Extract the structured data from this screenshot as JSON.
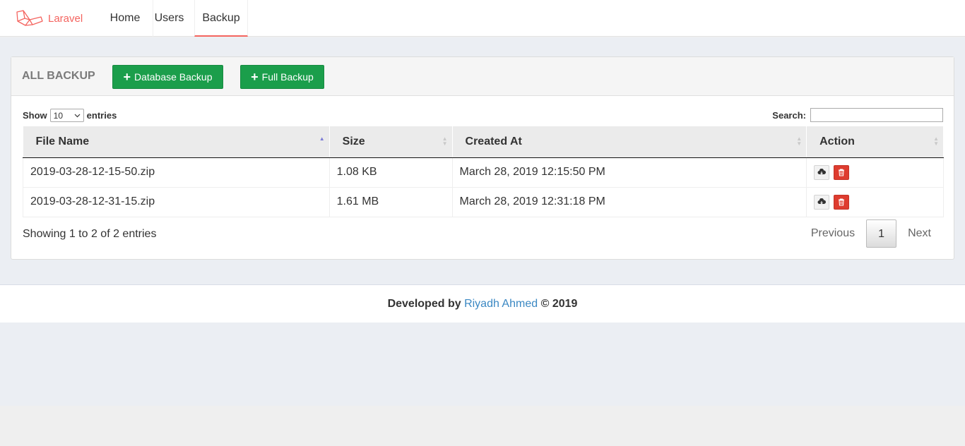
{
  "brand": {
    "name": "Laravel",
    "color": "#f4645f"
  },
  "nav": {
    "home": "Home",
    "users": "Users",
    "backup": "Backup",
    "active": "Backup"
  },
  "panel": {
    "title": "ALL BACKUP",
    "db_backup_label": "Database Backup",
    "full_backup_label": "Full Backup"
  },
  "table": {
    "show_label": "Show",
    "page_length": "10",
    "entries_label": "entries",
    "search_label": "Search:",
    "search_value": "",
    "columns": [
      "File Name",
      "Size",
      "Created At",
      "Action"
    ],
    "sorted_column": "File Name",
    "rows": [
      {
        "file": "2019-03-28-12-15-50.zip",
        "size": "1.08 KB",
        "created": "March 28, 2019 12:15:50 PM"
      },
      {
        "file": "2019-03-28-12-31-15.zip",
        "size": "1.61 MB",
        "created": "March 28, 2019 12:31:18 PM"
      }
    ],
    "info": "Showing 1 to 2 of 2 entries",
    "pagination": {
      "previous": "Previous",
      "current": "1",
      "next": "Next"
    }
  },
  "footer": {
    "prefix": "Developed by",
    "author": "Riyadh Ahmed",
    "suffix": "© 2019"
  },
  "colors": {
    "button_green": "#1b9e4b",
    "delete_red": "#de3c2f",
    "link_blue": "#3b88c3"
  }
}
